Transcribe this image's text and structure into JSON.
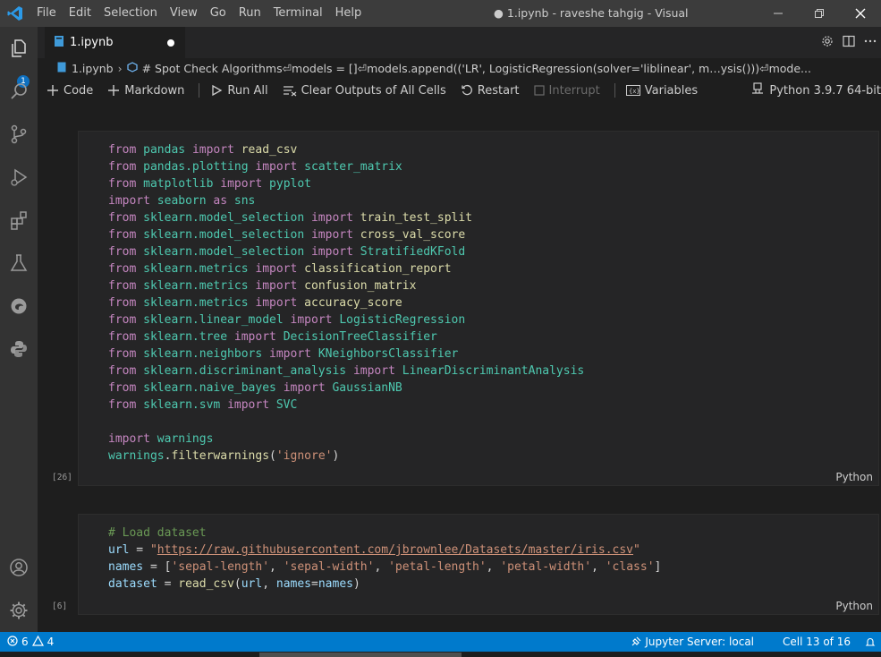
{
  "titlebar": {
    "menu": [
      "File",
      "Edit",
      "Selection",
      "View",
      "Go",
      "Run",
      "Terminal",
      "Help"
    ],
    "window_title": "● 1.ipynb - raveshe tahgig - Visual"
  },
  "activity": {
    "badge": "1"
  },
  "tab": {
    "label": "1.ipynb"
  },
  "breadcrumb": {
    "file": "1.ipynb",
    "cell": "# Spot Check Algorithms⏎models = []⏎models.append(('LR', LogisticRegression(solver='liblinear', m…ysis()))⏎mode..."
  },
  "toolbar": {
    "code": "Code",
    "markdown": "Markdown",
    "run_all": "Run All",
    "clear_outputs": "Clear Outputs of All Cells",
    "restart": "Restart",
    "interrupt": "Interrupt",
    "variables": "Variables",
    "kernel": "Python 3.9.7 64-bit"
  },
  "cells": [
    {
      "exec_count": "[26]",
      "language": "Python",
      "lines": [
        "from pandas import read_csv",
        "from pandas.plotting import scatter_matrix",
        "from matplotlib import pyplot",
        "import seaborn as sns",
        "from sklearn.model_selection import train_test_split",
        "from sklearn.model_selection import cross_val_score",
        "from sklearn.model_selection import StratifiedKFold",
        "from sklearn.metrics import classification_report",
        "from sklearn.metrics import confusion_matrix",
        "from sklearn.metrics import accuracy_score",
        "from sklearn.linear_model import LogisticRegression",
        "from sklearn.tree import DecisionTreeClassifier",
        "from sklearn.neighbors import KNeighborsClassifier",
        "from sklearn.discriminant_analysis import LinearDiscriminantAnalysis",
        "from sklearn.naive_bayes import GaussianNB",
        "from sklearn.svm import SVC",
        "",
        "import warnings",
        "warnings.filterwarnings('ignore')"
      ]
    },
    {
      "exec_count": "[6]",
      "language": "Python",
      "lines": [
        "# Load dataset",
        "url = \"https://raw.githubusercontent.com/jbrownlee/Datasets/master/iris.csv\"",
        "names = ['sepal-length', 'sepal-width', 'petal-length', 'petal-width', 'class']",
        "dataset = read_csv(url, names=names)"
      ]
    }
  ],
  "statusbar": {
    "errors": "6",
    "warnings": "4",
    "jupyter_server": "Jupyter Server: local",
    "cell_position": "Cell 13 of 16"
  },
  "colors": {
    "accent": "#007acc",
    "keyword": "#c586c0",
    "module": "#4ec9b0",
    "string": "#ce9178",
    "comment": "#6a9955"
  }
}
